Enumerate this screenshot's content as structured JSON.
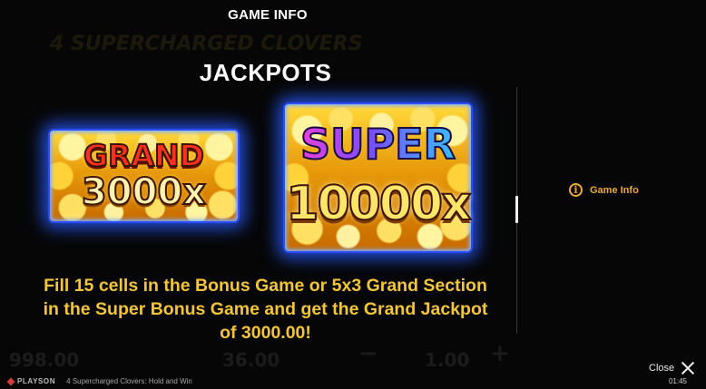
{
  "background": {
    "logo": "4 SUPERCHARGED CLOVERS",
    "balance": "998.00",
    "bet": "36.00",
    "minus": "−",
    "lines": "1.00",
    "plus": "+"
  },
  "header": {
    "title": "GAME INFO"
  },
  "section": {
    "heading": "JACKPOTS"
  },
  "jackpots": [
    {
      "name": "GRAND",
      "multiplier": "3000x"
    },
    {
      "name": "SUPER",
      "multiplier": "10000x"
    }
  ],
  "description": "Fill 15 cells in the Bonus Game or 5x3 Grand Section in the Super Bonus Game and get the Grand Jackpot of 3000.00!",
  "menu": {
    "items": [
      {
        "label": "Game Info",
        "icon": "info-icon"
      }
    ]
  },
  "close": {
    "label": "Close"
  },
  "footer": {
    "brand": "PLAYSON",
    "game_name": "4 Supercharged Clovers: Hold and Win",
    "time": "01:45"
  },
  "colors": {
    "accent": "#f0a83a",
    "description_text": "#f3c53b",
    "jackpot_glow": "#2a4dff"
  }
}
